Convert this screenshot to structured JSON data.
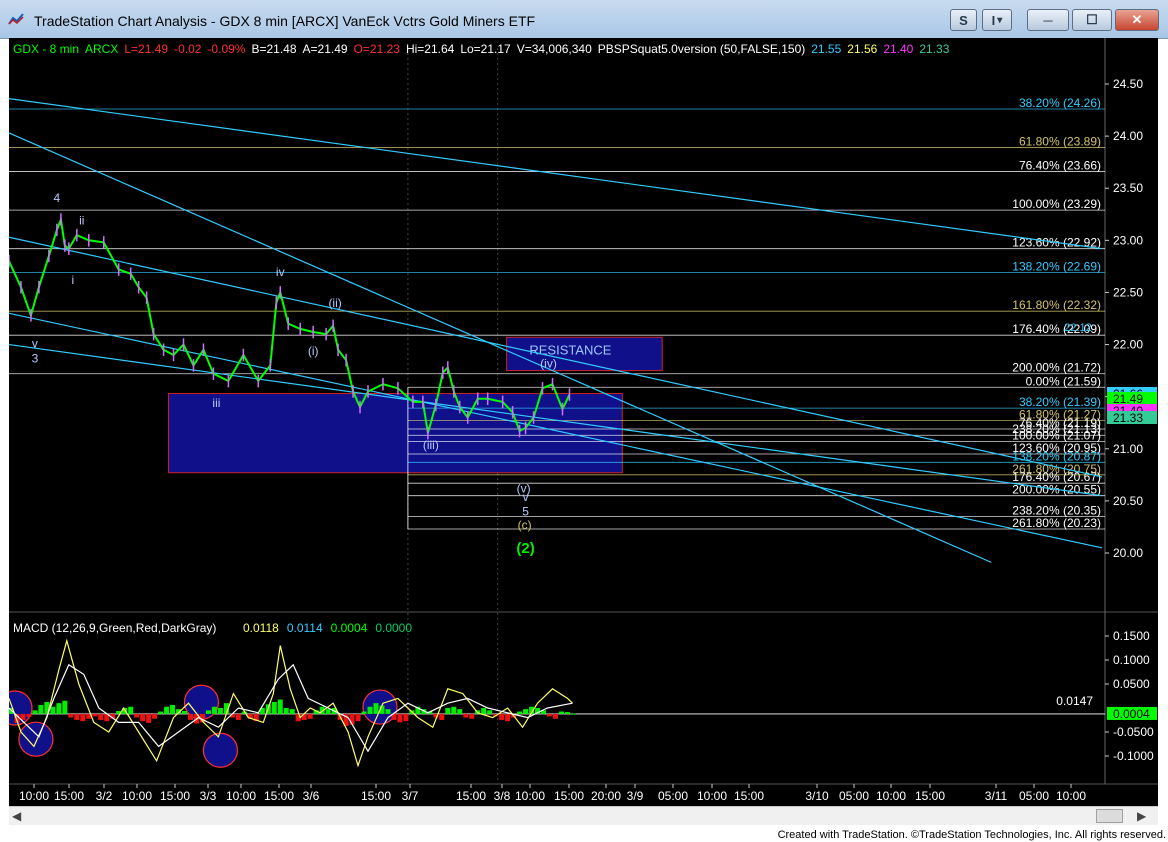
{
  "window": {
    "title": "TradeStation Chart Analysis - GDX 8 min [ARCX] VanEck Vctrs Gold Miners ETF",
    "buttons": {
      "s": "S",
      "i": "I",
      "dropdown": "▾",
      "minimize": "─",
      "maximize": "☐",
      "close": "✕"
    }
  },
  "credit": "Created with TradeStation. ©TradeStation Technologies, Inc. All rights reserved.",
  "chart_data": [
    {
      "type": "line",
      "title": "",
      "header": [
        {
          "text": "GDX - 8 min",
          "color": "#00ff00"
        },
        {
          "text": "ARCX",
          "color": "#00ff00"
        },
        {
          "text": "L=21.49",
          "color": "#ff3030"
        },
        {
          "text": "-0.02",
          "color": "#ff3030"
        },
        {
          "text": "-0.09%",
          "color": "#ff3030"
        },
        {
          "text": "B=21.48",
          "color": "#ffffff"
        },
        {
          "text": "A=21.49",
          "color": "#ffffff"
        },
        {
          "text": "O=21.23",
          "color": "#ff3030"
        },
        {
          "text": "Hi=21.64",
          "color": "#ffffff"
        },
        {
          "text": "Lo=21.17",
          "color": "#ffffff"
        },
        {
          "text": "V=34,006,340",
          "color": "#ffffff"
        },
        {
          "text": "PBSPSquat5.0version (50,FALSE,150)",
          "color": "#ffffff"
        },
        {
          "text": "21.55",
          "color": "#33ccff"
        },
        {
          "text": "21.56",
          "color": "#ffff66"
        },
        {
          "text": "21.40",
          "color": "#ff33ff"
        },
        {
          "text": "21.33",
          "color": "#33cc99"
        }
      ],
      "ylim": [
        19.6,
        24.75
      ],
      "y_ticks": [
        "24.50",
        "24.00",
        "23.50",
        "23.00",
        "22.50",
        "22.00",
        "21.50",
        "21.00",
        "20.50",
        "20.00"
      ],
      "x_ticks": [
        "10:00",
        "15:00",
        "3/2",
        "10:00",
        "15:00",
        "3/3",
        "10:00",
        "15:00",
        "3/6",
        "15:00",
        "3/7",
        "15:00",
        "3/8",
        "10:00",
        "15:00",
        "20:00",
        "3/9",
        "05:00",
        "10:00",
        "15:00",
        "3/10",
        "05:00",
        "10:00",
        "15:00",
        "3/11",
        "05:00",
        "10:00"
      ],
      "price_tags": [
        {
          "label": "21.66",
          "value": 21.66,
          "bg": "#33ccff",
          "fg": "#000000"
        },
        {
          "label": "21.49",
          "value": 21.49,
          "bg": "#00ff00",
          "fg": "#000000"
        },
        {
          "label": "21.40",
          "value": 21.4,
          "bg": "#ff33ff",
          "fg": "#000000"
        },
        {
          "label": "21.33",
          "value": 21.33,
          "bg": "#33cc99",
          "fg": "#000000"
        }
      ],
      "fib_levels_upper": [
        {
          "label": "38.20% (24.26)",
          "value": 24.26,
          "color": "#33ccff"
        },
        {
          "label": "61.80% (23.89)",
          "value": 23.89,
          "color": "#d4c36a"
        },
        {
          "label": "76.40% (23.66)",
          "value": 23.66,
          "color": "#ffffff"
        },
        {
          "label": "100.00% (23.29)",
          "value": 23.29,
          "color": "#ffffff"
        },
        {
          "label": "123.60% (22.92)",
          "value": 22.92,
          "color": "#ffffff"
        },
        {
          "label": "138.20% (22.69)",
          "value": 22.69,
          "color": "#33ccff"
        },
        {
          "label": "161.80% (22.32)",
          "value": 22.32,
          "color": "#d4c36a"
        },
        {
          "label": "176.40% (22.09)",
          "value": 22.09,
          "color": "#ffffff"
        },
        {
          "label": "200.00% (21.72)",
          "value": 21.72,
          "color": "#ffffff"
        }
      ],
      "fib_levels_lower": [
        {
          "label": "0.00% (21.59)",
          "value": 21.59,
          "color": "#ffffff"
        },
        {
          "label": "38.20% (21.39)",
          "value": 21.39,
          "color": "#33ccff"
        },
        {
          "label": "61.80% (21.27)",
          "value": 21.27,
          "color": "#d4c36a"
        },
        {
          "label": "76.40% (21.19)",
          "value": 21.19,
          "color": "#ffffff"
        },
        {
          "label": "238.20% (21.13)",
          "value": 21.13,
          "color": "#ffffff"
        },
        {
          "label": "100.00% (21.07)",
          "value": 21.07,
          "color": "#ffffff"
        },
        {
          "label": "123.60% (20.95)",
          "value": 20.95,
          "color": "#ffffff"
        },
        {
          "label": "138.20% (20.87)",
          "value": 20.87,
          "color": "#33ccff"
        },
        {
          "label": "261.80% (20.75)",
          "value": 20.75,
          "color": "#d4c36a"
        },
        {
          "label": "176.40% (20.67)",
          "value": 20.67,
          "color": "#ffffff"
        },
        {
          "label": "200.00% (20.55)",
          "value": 20.55,
          "color": "#ffffff"
        },
        {
          "label": "238.20% (20.35)",
          "value": 20.35,
          "color": "#ffffff"
        },
        {
          "label": "261.80% (20.23)",
          "value": 20.23,
          "color": "#ffffff"
        }
      ],
      "floating_price_label": "22.12",
      "annotations": [
        {
          "text": "4",
          "t": 48,
          "value": 23.37
        },
        {
          "text": "ii",
          "t": 73,
          "value": 23.15
        },
        {
          "text": "i",
          "t": 64,
          "value": 22.58
        },
        {
          "text": "v",
          "t": 26,
          "value": 21.97
        },
        {
          "text": "3",
          "t": 26,
          "value": 21.83
        },
        {
          "text": "iv",
          "t": 272,
          "value": 22.66
        },
        {
          "text": "(ii)",
          "t": 327,
          "value": 22.36
        },
        {
          "text": "(i)",
          "t": 305,
          "value": 21.9
        },
        {
          "text": "iii",
          "t": 208,
          "value": 21.4
        },
        {
          "text": "(iii)",
          "t": 423,
          "value": 21.0
        },
        {
          "text": "(iv)",
          "t": 541,
          "value": 21.78
        },
        {
          "text": "(v)",
          "t": 516,
          "value": 20.58
        },
        {
          "text": "v",
          "t": 518,
          "value": 20.5
        },
        {
          "text": "5",
          "t": 518,
          "value": 20.36
        },
        {
          "text": "(c)",
          "t": 517,
          "value": 20.23
        },
        {
          "text": "(2)",
          "t": 518,
          "value": 20.0
        }
      ],
      "resistance_box": {
        "label": "RESISTANCE",
        "t_start": 499,
        "t_end": 655,
        "value_top": 22.07,
        "value_bottom": 21.75
      },
      "support_box": {
        "t_start": 160,
        "t_end": 615,
        "value_top": 21.53,
        "value_bottom": 20.77
      },
      "trendlines": [
        {
          "t": [
            0,
            1096
          ],
          "values": [
            24.36,
            22.92
          ]
        },
        {
          "t": [
            0,
            1096
          ],
          "values": [
            23.03,
            20.73
          ]
        },
        {
          "t": [
            0,
            1096
          ],
          "values": [
            22.3,
            20.05
          ]
        },
        {
          "t": [
            0,
            1096
          ],
          "values": [
            22.0,
            20.55
          ]
        },
        {
          "t": [
            0,
            985
          ],
          "values": [
            24.03,
            19.91
          ]
        }
      ],
      "price_series": {
        "t": [
          0,
          12,
          22,
          30,
          40,
          48,
          52,
          56,
          60,
          68,
          80,
          95,
          110,
          122,
          130,
          138,
          145,
          155,
          165,
          175,
          185,
          195,
          205,
          220,
          235,
          250,
          262,
          268,
          272,
          280,
          292,
          305,
          318,
          325,
          330,
          338,
          345,
          352,
          360,
          375,
          390,
          405,
          415,
          420,
          428,
          435,
          440,
          446,
          452,
          460,
          470,
          480,
          495,
          505,
          512,
          518,
          526,
          535,
          545,
          555,
          562
        ],
        "values": [
          22.8,
          22.55,
          22.28,
          22.55,
          22.85,
          23.1,
          23.2,
          22.95,
          22.92,
          23.05,
          23.0,
          22.98,
          22.72,
          22.68,
          22.55,
          22.45,
          22.1,
          21.95,
          21.9,
          22.0,
          21.8,
          21.95,
          21.72,
          21.65,
          21.9,
          21.65,
          21.8,
          22.4,
          22.5,
          22.2,
          22.15,
          22.12,
          22.1,
          22.18,
          21.95,
          21.85,
          21.55,
          21.4,
          21.55,
          21.62,
          21.58,
          21.45,
          21.45,
          21.15,
          21.42,
          21.73,
          21.78,
          21.55,
          21.4,
          21.3,
          21.48,
          21.48,
          21.45,
          21.35,
          21.17,
          21.2,
          21.3,
          21.58,
          21.62,
          21.38,
          21.52
        ]
      }
    },
    {
      "type": "line",
      "title": "MACD (12,26,9,Green,Red,DarkGray)",
      "values_label": [
        {
          "text": "0.0118",
          "color": "#ffff66"
        },
        {
          "text": "0.0114",
          "color": "#33ccff"
        },
        {
          "text": "0.0004",
          "color": "#00ff00"
        },
        {
          "text": "0.0000",
          "color": "#00cc66"
        }
      ],
      "ylim": [
        -0.16,
        0.17
      ],
      "y_ticks": [
        "0.1500",
        "0.1000",
        "0.0500",
        "-0.0500",
        "-0.1000"
      ],
      "reference_line": {
        "label": "0.0147",
        "value": 0.0147
      },
      "current_tag": {
        "label": "0.0004",
        "value": 0.0004,
        "bg": "#00ff00",
        "fg": "#000000"
      },
      "series": [
        {
          "name": "MACD",
          "color": "#ffff66",
          "t": [
            0,
            12,
            25,
            38,
            50,
            58,
            70,
            85,
            100,
            115,
            130,
            148,
            165,
            180,
            195,
            210,
            225,
            240,
            255,
            265,
            272,
            282,
            292,
            302,
            312,
            325,
            340,
            350,
            360,
            375,
            390,
            410,
            425,
            440,
            455,
            470,
            485,
            500,
            515,
            530,
            545,
            560,
            565
          ],
          "values": [
            0.02,
            -0.05,
            -0.08,
            -0.02,
            0.08,
            0.14,
            0.05,
            -0.03,
            -0.05,
            0.0,
            -0.05,
            -0.11,
            -0.02,
            0.01,
            -0.03,
            -0.06,
            0.03,
            -0.02,
            -0.03,
            0.03,
            0.13,
            0.04,
            -0.02,
            0.0,
            -0.01,
            0.01,
            -0.05,
            -0.12,
            -0.06,
            0.01,
            0.02,
            -0.02,
            -0.04,
            0.04,
            0.03,
            -0.01,
            -0.02,
            0.0,
            -0.04,
            0.01,
            0.04,
            0.02,
            0.01
          ]
        },
        {
          "name": "Signal",
          "color": "#ffffff",
          "t": [
            0,
            15,
            30,
            45,
            60,
            75,
            90,
            110,
            130,
            150,
            170,
            190,
            210,
            230,
            250,
            270,
            285,
            300,
            320,
            340,
            360,
            380,
            400,
            420,
            440,
            460,
            480,
            500,
            520,
            540,
            565
          ],
          "values": [
            0.0,
            -0.03,
            -0.06,
            0.02,
            0.09,
            0.07,
            0.0,
            -0.03,
            -0.03,
            -0.08,
            -0.05,
            -0.02,
            -0.04,
            0.0,
            -0.01,
            0.06,
            0.09,
            0.02,
            0.0,
            -0.02,
            -0.09,
            -0.02,
            0.01,
            -0.01,
            0.01,
            0.02,
            0.0,
            -0.01,
            -0.02,
            0.0,
            0.01
          ]
        }
      ],
      "histogram": {
        "t": [
          2,
          8,
          14,
          20,
          26,
          32,
          38,
          44,
          50,
          56,
          62,
          68,
          74,
          80,
          86,
          92,
          98,
          104,
          110,
          116,
          122,
          128,
          134,
          140,
          146,
          152,
          158,
          164,
          170,
          176,
          182,
          188,
          194,
          200,
          206,
          212,
          218,
          224,
          230,
          236,
          242,
          248,
          254,
          260,
          266,
          272,
          278,
          284,
          290,
          296,
          302,
          308,
          314,
          320,
          326,
          332,
          338,
          344,
          350,
          356,
          362,
          368,
          374,
          380,
          386,
          392,
          398,
          404,
          410,
          416,
          422,
          428,
          434,
          440,
          446,
          452,
          458,
          464,
          470,
          476,
          482,
          488,
          494,
          500,
          506,
          512,
          518,
          524,
          530,
          536,
          542,
          548,
          554,
          560,
          566
        ],
        "values": [
          0.01,
          -0.015,
          -0.01,
          -0.005,
          0.006,
          0.015,
          0.02,
          0.012,
          0.018,
          0.022,
          -0.006,
          -0.01,
          -0.012,
          -0.008,
          -0.004,
          -0.01,
          -0.012,
          -0.008,
          0.005,
          0.01,
          0.012,
          -0.006,
          -0.012,
          -0.015,
          -0.008,
          0.004,
          0.012,
          0.015,
          0.008,
          0.005,
          -0.01,
          -0.016,
          -0.014,
          0.006,
          0.012,
          0.01,
          0.018,
          -0.006,
          -0.01,
          0.004,
          -0.008,
          -0.012,
          0.01,
          0.016,
          0.02,
          0.024,
          0.01,
          0.008,
          -0.012,
          -0.01,
          -0.008,
          0.006,
          0.012,
          0.008,
          0.01,
          -0.01,
          -0.02,
          -0.018,
          -0.012,
          0.004,
          0.012,
          0.018,
          0.014,
          0.008,
          -0.01,
          -0.014,
          -0.012,
          0.006,
          0.012,
          0.008,
          0.004,
          -0.006,
          -0.01,
          0.01,
          0.012,
          0.008,
          -0.006,
          -0.008,
          0.006,
          0.01,
          0.006,
          -0.004,
          -0.01,
          -0.012,
          -0.006,
          0.004,
          0.008,
          0.012,
          0.01,
          0.006,
          -0.004,
          -0.008,
          0.004,
          0.003,
          0.0004
        ]
      },
      "circles": [
        {
          "t": 6,
          "value": 0.0,
          "color": "#ff3030"
        },
        {
          "t": 27,
          "value": -0.065,
          "color": "#ff3030"
        },
        {
          "t": 193,
          "value": 0.012,
          "color": "#ff3030"
        },
        {
          "t": 212,
          "value": -0.088,
          "color": "#ff3030"
        },
        {
          "t": 372,
          "value": 0.002,
          "color": "#ff3030"
        }
      ]
    }
  ]
}
